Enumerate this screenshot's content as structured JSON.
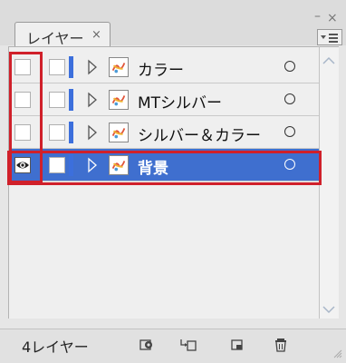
{
  "panel": {
    "tab_label": "レイヤー",
    "tab_close": "×",
    "min_symbol": "–",
    "close_symbol": "×"
  },
  "layers": [
    {
      "name": "カラー",
      "visible": false,
      "selected": false
    },
    {
      "name": "MTシルバー",
      "visible": false,
      "selected": false
    },
    {
      "name": "シルバー＆カラー",
      "visible": false,
      "selected": false
    },
    {
      "name": "背景",
      "visible": true,
      "selected": true
    }
  ],
  "footer": {
    "layer_count": "4レイヤー"
  },
  "colors": {
    "selection": "#3f6fcf",
    "layer_color": "#3c6fdc",
    "highlight": "#d0202a"
  }
}
